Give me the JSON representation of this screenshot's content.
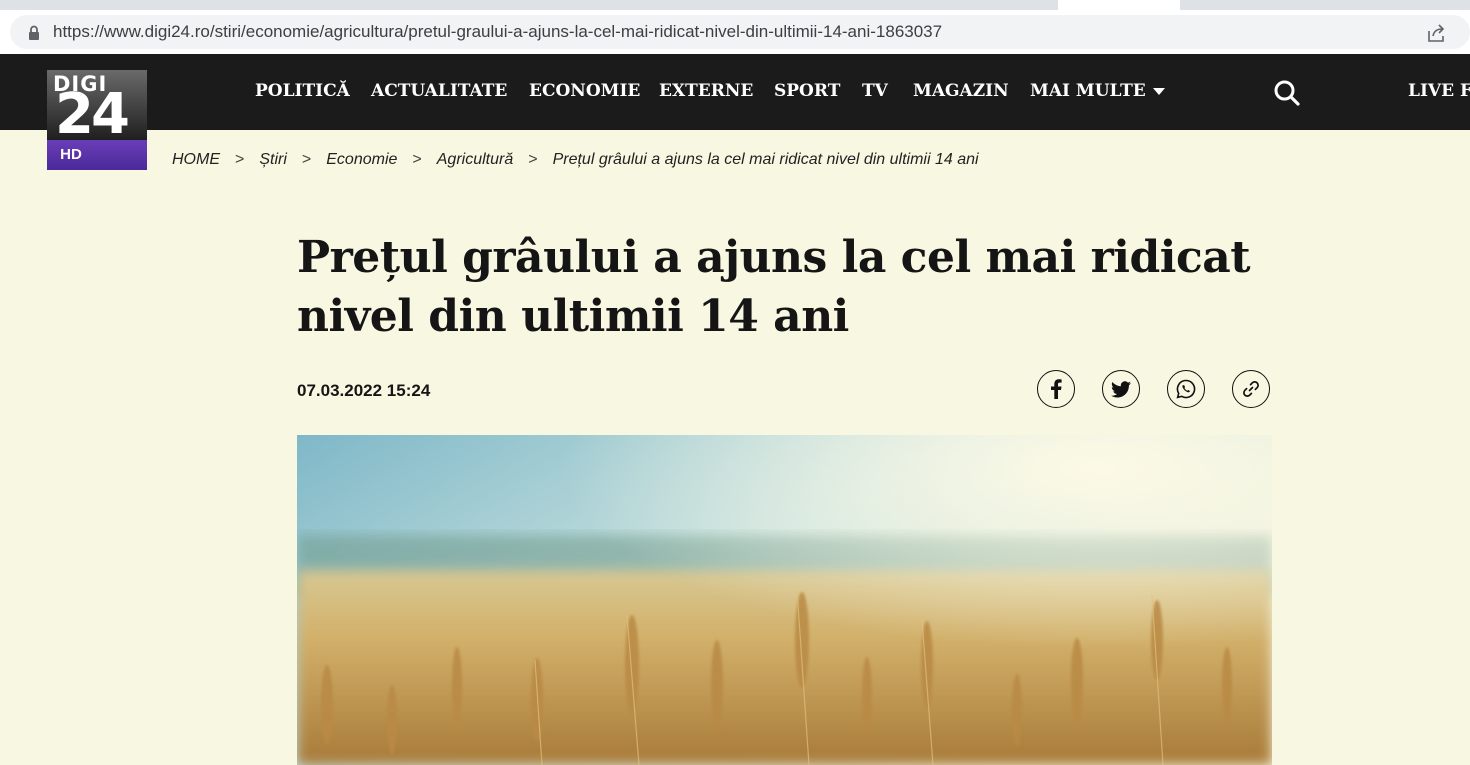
{
  "browser": {
    "url": "https://www.digi24.ro/stiri/economie/agricultura/pretul-graului-a-ajuns-la-cel-mai-ridicat-nivel-din-ultimii-14-ani-1863037"
  },
  "logo": {
    "top": "DIGI",
    "number": "24",
    "badge": "HD"
  },
  "nav": {
    "items": [
      "POLITICĂ",
      "ACTUALITATE",
      "ECONOMIE",
      "EXTERNE",
      "SPORT",
      "TV",
      "MAGAZIN",
      "MAI MULTE"
    ],
    "live": "LIVE FI"
  },
  "breadcrumb": [
    "HOME",
    "Știri",
    "Economie",
    "Agricultură",
    "Prețul grâului a ajuns la cel mai ridicat nivel din ultimii 14 ani"
  ],
  "breadcrumb_separator": ">",
  "article": {
    "title": "Prețul grâului a ajuns la cel mai ridicat nivel din ultimii 14 ani",
    "date": "07.03.2022 15:24",
    "share_icons": [
      "facebook-icon",
      "twitter-icon",
      "whatsapp-icon",
      "link-icon"
    ]
  },
  "colors": {
    "page_background": "#f8f8e2",
    "nav_background": "#1b1b1b",
    "logo_badge": "#5a34a8"
  }
}
